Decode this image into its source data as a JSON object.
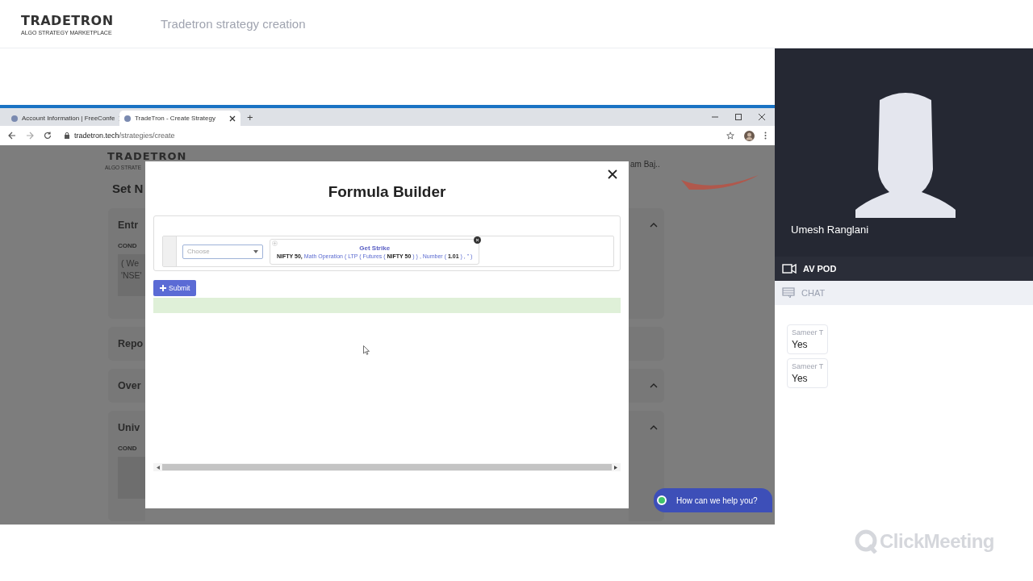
{
  "header": {
    "logo": "TRADETRON",
    "tagline": "ALGO STRATEGY MARKETPLACE",
    "title": "Tradetron strategy creation"
  },
  "browser": {
    "tabs": [
      {
        "label": "Account Information | FreeConfe",
        "selected": false
      },
      {
        "label": "TradeTron - Create Strategy",
        "selected": true
      }
    ],
    "new_tab": "+",
    "url_host": "tradetron.tech",
    "url_path": "/strategies/create"
  },
  "page": {
    "logo": "TRADETRON",
    "tagline": "ALGO STRATE",
    "heading": "Set N",
    "user": "am Baj..",
    "sections": [
      {
        "title": "Entr",
        "label": "COND",
        "lines": [
          "( We",
          "'NSE'"
        ],
        "expanded": true
      },
      {
        "title": "Repo",
        "expanded": false
      },
      {
        "title": "Over",
        "expanded": true
      },
      {
        "title": "Univ",
        "label": "COND",
        "expanded": true
      }
    ]
  },
  "modal": {
    "title": "Formula Builder",
    "select": {
      "placeholder": "Choose"
    },
    "block": {
      "title": "Get Strike",
      "formula": [
        {
          "text": "NIFTY 50, ",
          "kind": "plain"
        },
        {
          "text": "Math Operation ( LTP ( Futures ( ",
          "kind": "func"
        },
        {
          "text": "NIFTY 50 ",
          "kind": "plain"
        },
        {
          "text": ") ) , Number ( ",
          "kind": "func"
        },
        {
          "text": "1.01 ",
          "kind": "plain"
        },
        {
          "text": ") , \" )",
          "kind": "func"
        }
      ]
    },
    "submit": "Submit"
  },
  "help": {
    "label": "How can we help you?"
  },
  "video": {
    "name": "Umesh Ranglani"
  },
  "panel_tabs": [
    {
      "label": "AV POD",
      "kind": "video",
      "selected": true
    },
    {
      "label": "CHAT",
      "kind": "chat",
      "selected": false
    }
  ],
  "messages": [
    {
      "author": "Sameer T",
      "text": "Yes"
    },
    {
      "author": "Sameer T",
      "text": "Yes"
    }
  ],
  "brand": "ClickMeeting"
}
